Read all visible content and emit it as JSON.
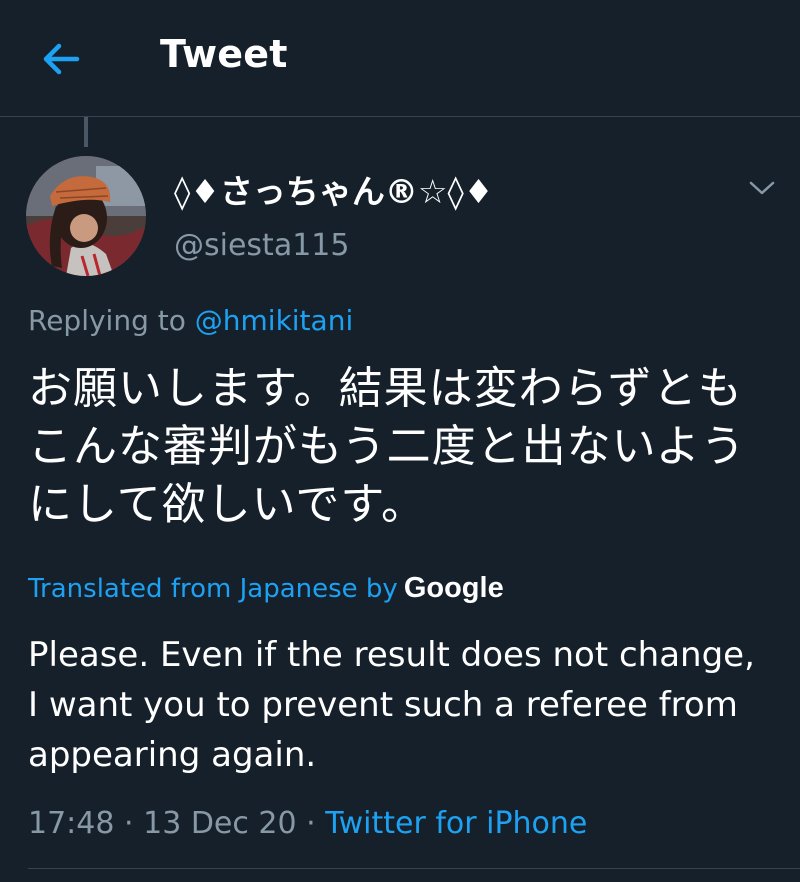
{
  "header": {
    "title": "Tweet",
    "back_icon": "arrow-left-icon"
  },
  "tweet": {
    "author": {
      "display_name": "◊♦さっちゃん®☆◊♦",
      "handle": "@siesta115"
    },
    "reply": {
      "prefix": "Replying to",
      "mention": "@hmikitani"
    },
    "text": "お願いします。結果は変わらずともこんな審判がもう二度と出ないようにして欲しいです。",
    "translation": {
      "label": "Translated from Japanese by",
      "provider": "Google",
      "text": "Please. Even if the result does not change, I want you to prevent such a referee from appearing again."
    },
    "meta": {
      "time": "17:48",
      "separator1": "·",
      "date": "13 Dec 20",
      "separator2": "·",
      "source": "Twitter for iPhone"
    }
  },
  "colors": {
    "background": "#15202b",
    "accent": "#1da1f2",
    "secondary_text": "#8899a6",
    "divider": "#38444d"
  }
}
